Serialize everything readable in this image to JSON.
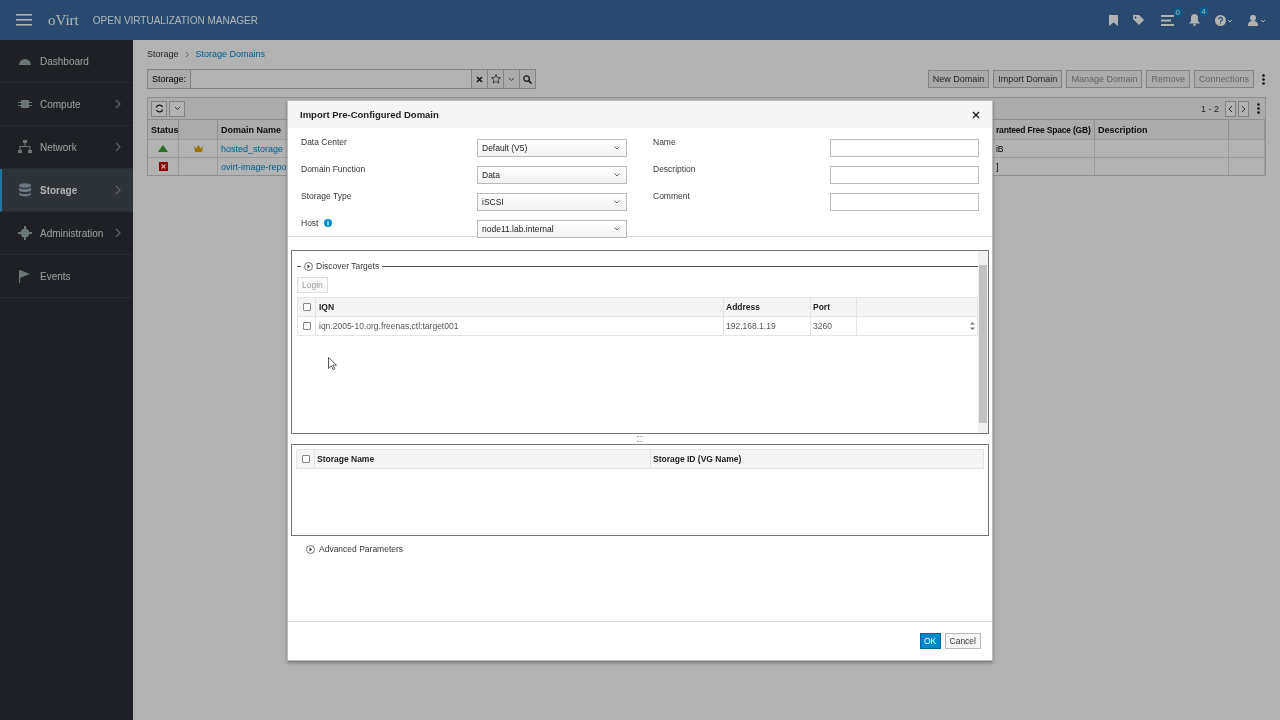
{
  "header": {
    "brand": "oVirt",
    "product": "OPEN VIRTUALIZATION MANAGER",
    "tasks_badge": "0",
    "events_badge": "4"
  },
  "sidebar": {
    "items": [
      {
        "label": "Dashboard",
        "expandable": false,
        "selected": false
      },
      {
        "label": "Compute",
        "expandable": true,
        "selected": false
      },
      {
        "label": "Network",
        "expandable": true,
        "selected": false
      },
      {
        "label": "Storage",
        "expandable": true,
        "selected": true
      },
      {
        "label": "Administration",
        "expandable": true,
        "selected": false
      },
      {
        "label": "Events",
        "expandable": false,
        "selected": false
      }
    ]
  },
  "breadcrumb": [
    "Storage",
    "Storage Domains"
  ],
  "search": {
    "label": "Storage:"
  },
  "actions": [
    {
      "label": "New Domain",
      "disabled": false
    },
    {
      "label": "Import Domain",
      "disabled": false
    },
    {
      "label": "Manage Domain",
      "disabled": true
    },
    {
      "label": "Remove",
      "disabled": true
    },
    {
      "label": "Connections",
      "disabled": true
    }
  ],
  "pager": "1 - 2",
  "table": {
    "columns": [
      "Status",
      "Domain Name",
      "ranteed Free Space (GB)",
      "Description"
    ],
    "rows": [
      {
        "up": true,
        "primary": true,
        "name": "hosted_storage",
        "column_4": "iB"
      },
      {
        "up": false,
        "primary": false,
        "name": "ovirt-image-repo",
        "column_4": "]"
      }
    ]
  },
  "dialog": {
    "title": "Import Pre-Configured Domain",
    "left_fields": [
      {
        "label": "Data Center",
        "value": "Default (V5)",
        "info": false
      },
      {
        "label": "Domain Function",
        "value": "Data",
        "info": false
      },
      {
        "label": "Storage Type",
        "value": "iSCSI",
        "info": false
      },
      {
        "label": "Host",
        "value": "node11.lab.internal",
        "info": true
      }
    ],
    "right_fields": [
      {
        "label": "Name"
      },
      {
        "label": "Description"
      },
      {
        "label": "Comment"
      }
    ],
    "discover": {
      "label": "Discover Targets",
      "expanded": false,
      "login": {
        "label": "Login",
        "disabled": true
      },
      "all_checked": false,
      "columns": [
        "IQN",
        "Address",
        "Port"
      ],
      "rows": [
        {
          "checked": false,
          "iqn": "iqn.2005-10.org.freenas.ctl:target001",
          "address": "192.168.1.19",
          "port": "3260"
        }
      ]
    },
    "luns": {
      "all_checked": false,
      "columns": [
        "Storage Name",
        "Storage ID (VG Name)"
      ]
    },
    "advanced": {
      "label": "Advanced Parameters",
      "expanded": false
    },
    "buttons": [
      {
        "label": "OK",
        "kind": "primary"
      },
      {
        "label": "Cancel",
        "kind": "default"
      }
    ]
  }
}
